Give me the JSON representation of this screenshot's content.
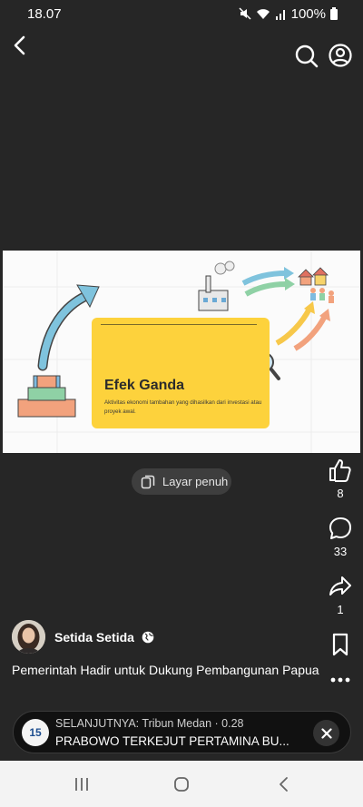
{
  "status": {
    "time": "18.07",
    "battery": "100%"
  },
  "video": {
    "card_title": "Efek Ganda",
    "card_description": "Aktivitas ekonomi tambahan yang dihasilkan dari investasi atau proyek awal."
  },
  "fullscreen_label": "Layar penuh",
  "actions": {
    "likes": "8",
    "comments": "33",
    "shares": "1"
  },
  "author": {
    "name": "Setida Setida"
  },
  "caption": "Pemerintah Hadir untuk Dukung Pembangunan Papua",
  "next_up": {
    "label": "SELANJUTNYA: Tribun Medan · 0.28",
    "title": "PRABOWO TERKEJUT PERTAMINA BU...",
    "logo_text": "15"
  },
  "icons": [
    "back-icon",
    "search-icon",
    "profile-icon",
    "like-icon",
    "comment-icon",
    "share-icon",
    "bookmark-icon",
    "more-icon",
    "close-icon",
    "fullscreen-icon",
    "globe-icon"
  ]
}
